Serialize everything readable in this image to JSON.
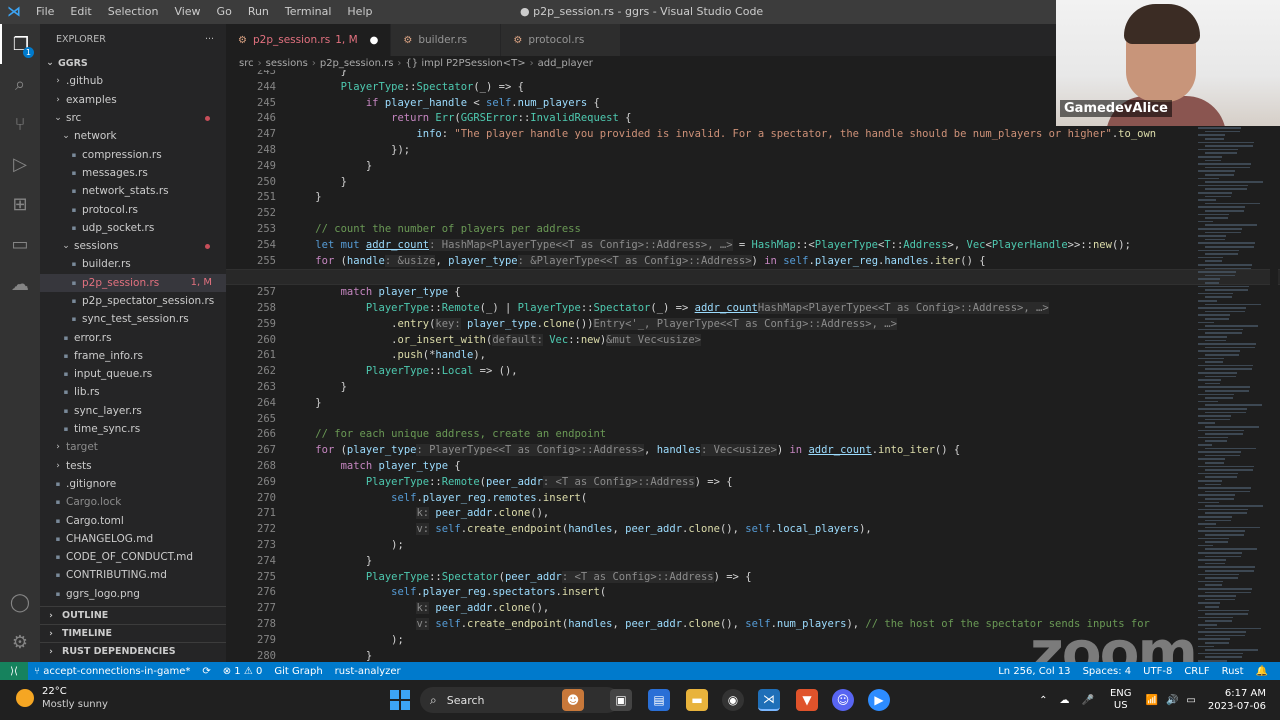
{
  "titlebar": {
    "menu": [
      "File",
      "Edit",
      "Selection",
      "View",
      "Go",
      "Run",
      "Terminal",
      "Help"
    ],
    "window_title": "● p2p_session.rs - ggrs - Visual Studio Code"
  },
  "sidebar": {
    "header": "EXPLORER",
    "more": "···",
    "root": "GGRS",
    "items": [
      {
        "label": ".github",
        "type": "folder",
        "indent": 1,
        "open": false
      },
      {
        "label": "examples",
        "type": "folder",
        "indent": 1,
        "open": false
      },
      {
        "label": "src",
        "type": "folder",
        "indent": 1,
        "open": true,
        "dot": true
      },
      {
        "label": "network",
        "type": "folder",
        "indent": 2,
        "open": true
      },
      {
        "label": "compression.rs",
        "type": "file",
        "indent": 3
      },
      {
        "label": "messages.rs",
        "type": "file",
        "indent": 3
      },
      {
        "label": "network_stats.rs",
        "type": "file",
        "indent": 3
      },
      {
        "label": "protocol.rs",
        "type": "file",
        "indent": 3
      },
      {
        "label": "udp_socket.rs",
        "type": "file",
        "indent": 3
      },
      {
        "label": "sessions",
        "type": "folder",
        "indent": 2,
        "open": true,
        "dot": true
      },
      {
        "label": "builder.rs",
        "type": "file",
        "indent": 3
      },
      {
        "label": "p2p_session.rs",
        "type": "file",
        "indent": 3,
        "selected": true,
        "mod": "1, M"
      },
      {
        "label": "p2p_spectator_session.rs",
        "type": "file",
        "indent": 3
      },
      {
        "label": "sync_test_session.rs",
        "type": "file",
        "indent": 3
      },
      {
        "label": "error.rs",
        "type": "file",
        "indent": 2
      },
      {
        "label": "frame_info.rs",
        "type": "file",
        "indent": 2
      },
      {
        "label": "input_queue.rs",
        "type": "file",
        "indent": 2
      },
      {
        "label": "lib.rs",
        "type": "file",
        "indent": 2
      },
      {
        "label": "sync_layer.rs",
        "type": "file",
        "indent": 2
      },
      {
        "label": "time_sync.rs",
        "type": "file",
        "indent": 2
      },
      {
        "label": "target",
        "type": "folder",
        "indent": 1,
        "open": false,
        "dim": true
      },
      {
        "label": "tests",
        "type": "folder",
        "indent": 1,
        "open": false
      },
      {
        "label": ".gitignore",
        "type": "file",
        "indent": 1
      },
      {
        "label": "Cargo.lock",
        "type": "file",
        "indent": 1,
        "dim": true
      },
      {
        "label": "Cargo.toml",
        "type": "file",
        "indent": 1
      },
      {
        "label": "CHANGELOG.md",
        "type": "file",
        "indent": 1
      },
      {
        "label": "CODE_OF_CONDUCT.md",
        "type": "file",
        "indent": 1
      },
      {
        "label": "CONTRIBUTING.md",
        "type": "file",
        "indent": 1
      },
      {
        "label": "ggrs_logo.png",
        "type": "file",
        "indent": 1
      }
    ],
    "sections": [
      "OUTLINE",
      "TIMELINE",
      "RUST DEPENDENCIES"
    ]
  },
  "tabs": [
    {
      "label": "p2p_session.rs",
      "badge": "1, M",
      "active": true,
      "dirty": true
    },
    {
      "label": "builder.rs",
      "active": false
    },
    {
      "label": "protocol.rs",
      "active": false
    }
  ],
  "breadcrumb": [
    "src",
    "sessions",
    "p2p_session.rs",
    "{} impl P2PSession<T>",
    "add_player"
  ],
  "editor": {
    "current_line": 256,
    "lines": [
      {
        "n": 243,
        "html": "        }"
      },
      {
        "n": 244,
        "html": "        <span class=\"ty\">PlayerType</span>::<span class=\"ty\">Spectator</span>(_) => {"
      },
      {
        "n": 245,
        "html": "            <span class=\"kw\">if</span> <span class=\"vr\">player_handle</span> < <span class=\"kw2\">self</span>.<span class=\"vr\">num_players</span> {"
      },
      {
        "n": 246,
        "html": "                <span class=\"kw\">return</span> <span class=\"ty\">Err</span>(<span class=\"ty\">GGRSError</span>::<span class=\"ty\">InvalidRequest</span> {"
      },
      {
        "n": 247,
        "html": "                    <span class=\"vr\">info</span>: <span class=\"st\">\"The player handle you provided is invalid. For a spectator, the handle should be num_players or higher\"</span>.<span class=\"fn\">to_own</span>"
      },
      {
        "n": 248,
        "html": "                });"
      },
      {
        "n": 249,
        "html": "            }"
      },
      {
        "n": 250,
        "html": "        }"
      },
      {
        "n": 251,
        "html": "    }"
      },
      {
        "n": 252,
        "html": ""
      },
      {
        "n": 253,
        "html": "    <span class=\"cm\">// count the number of players per address</span>"
      },
      {
        "n": 254,
        "html": "    <span class=\"kw2\">let</span> <span class=\"kw2\">mut</span> <span class=\"vr ul\">addr_count</span><span class=\"hint\">: HashMap&lt;PlayerType&lt;&lt;T as Config&gt;::Address&gt;, …&gt;</span> = <span class=\"ty\">HashMap</span>::&lt;<span class=\"ty\">PlayerType</span>&lt;<span class=\"ty\">T</span>::<span class=\"ty\">Address</span>&gt;, <span class=\"ty\">Vec</span>&lt;<span class=\"ty\">PlayerHandle</span>&gt;&gt;::<span class=\"fn\">new</span>();"
      },
      {
        "n": 255,
        "html": "    <span class=\"kw\">for</span> (<span class=\"vr\">handle</span><span class=\"hint\">: &amp;usize</span>, <span class=\"vr\">player_type</span><span class=\"hint\">: &amp;PlayerType&lt;&lt;T as Config&gt;::Address&gt;</span>) <span class=\"kw\">in</span> <span class=\"kw2\">self</span>.<span class=\"vr\">player_reg</span>.<span class=\"vr\">handles</span>.<span class=\"fn\">iter</span>() {"
      },
      {
        "n": 256,
        "html": "        "
      },
      {
        "n": 257,
        "html": "        <span class=\"kw\">match</span> <span class=\"vr\">player_type</span> {"
      },
      {
        "n": 258,
        "html": "            <span class=\"ty\">PlayerType</span>::<span class=\"ty\">Remote</span>(_) | <span class=\"ty\">PlayerType</span>::<span class=\"ty\">Spectator</span>(_) => <span class=\"vr ul\">addr_count</span><span class=\"hint\">HashMap&lt;PlayerType&lt;&lt;T as Config&gt;::Address&gt;, …&gt;</span>"
      },
      {
        "n": 259,
        "html": "                .<span class=\"fn\">entry</span>(<span class=\"hint\">key:</span> <span class=\"vr\">player_type</span>.<span class=\"fn\">clone</span>())<span class=\"hint\">Entry&lt;'_, PlayerType&lt;&lt;T as Config&gt;::Address&gt;, …&gt;</span>"
      },
      {
        "n": 260,
        "html": "                .<span class=\"fn\">or_insert_with</span>(<span class=\"hint\">default:</span> <span class=\"ty\">Vec</span>::<span class=\"fn\">new</span>)<span class=\"hint\">&amp;mut Vec&lt;usize&gt;</span>"
      },
      {
        "n": 261,
        "html": "                .<span class=\"fn\">push</span>(*<span class=\"vr\">handle</span>),"
      },
      {
        "n": 262,
        "html": "            <span class=\"ty\">PlayerType</span>::<span class=\"ty\">Local</span> => (),"
      },
      {
        "n": 263,
        "html": "        }"
      },
      {
        "n": 264,
        "html": "    }"
      },
      {
        "n": 265,
        "html": ""
      },
      {
        "n": 266,
        "html": "    <span class=\"cm\">// for each unique address, create an endpoint</span>"
      },
      {
        "n": 267,
        "html": "    <span class=\"kw\">for</span> (<span class=\"vr\">player_type</span><span class=\"hint\">: PlayerType&lt;&lt;T as Config&gt;::Address&gt;</span>, <span class=\"vr\">handles</span><span class=\"hint\">: Vec&lt;usize&gt;</span>) <span class=\"kw\">in</span> <span class=\"vr ul\">addr_count</span>.<span class=\"fn\">into_iter</span>() {"
      },
      {
        "n": 268,
        "html": "        <span class=\"kw\">match</span> <span class=\"vr\">player_type</span> {"
      },
      {
        "n": 269,
        "html": "            <span class=\"ty\">PlayerType</span>::<span class=\"ty\">Remote</span>(<span class=\"vr\">peer_addr</span><span class=\"hint\">: &lt;T as Config&gt;::Address</span>) => {"
      },
      {
        "n": 270,
        "html": "                <span class=\"kw2\">self</span>.<span class=\"vr\">player_reg</span>.<span class=\"vr\">remotes</span>.<span class=\"fn\">insert</span>("
      },
      {
        "n": 271,
        "html": "                    <span class=\"hint\">k:</span> <span class=\"vr\">peer_addr</span>.<span class=\"fn\">clone</span>(),"
      },
      {
        "n": 272,
        "html": "                    <span class=\"hint\">v:</span> <span class=\"kw2\">self</span>.<span class=\"fn\">create_endpoint</span>(<span class=\"vr\">handles</span>, <span class=\"vr\">peer_addr</span>.<span class=\"fn\">clone</span>(), <span class=\"kw2\">self</span>.<span class=\"vr\">local_players</span>),"
      },
      {
        "n": 273,
        "html": "                );"
      },
      {
        "n": 274,
        "html": "            }"
      },
      {
        "n": 275,
        "html": "            <span class=\"ty\">PlayerType</span>::<span class=\"ty\">Spectator</span>(<span class=\"vr\">peer_addr</span><span class=\"hint\">: &lt;T as Config&gt;::Address</span>) => {"
      },
      {
        "n": 276,
        "html": "                <span class=\"kw2\">self</span>.<span class=\"vr\">player_reg</span>.<span class=\"vr\">spectators</span>.<span class=\"fn\">insert</span>("
      },
      {
        "n": 277,
        "html": "                    <span class=\"hint\">k:</span> <span class=\"vr\">peer_addr</span>.<span class=\"fn\">clone</span>(),"
      },
      {
        "n": 278,
        "html": "                    <span class=\"hint\">v:</span> <span class=\"kw2\">self</span>.<span class=\"fn\">create_endpoint</span>(<span class=\"vr\">handles</span>, <span class=\"vr\">peer_addr</span>.<span class=\"fn\">clone</span>(), <span class=\"kw2\">self</span>.<span class=\"vr\">num_players</span>), <span class=\"cm\">// the host of the spectator sends inputs for</span>"
      },
      {
        "n": 279,
        "html": "                );"
      },
      {
        "n": 280,
        "html": "            }"
      }
    ]
  },
  "webcam": {
    "name": "GamedevAlice"
  },
  "watermark": "zoom",
  "statusbar": {
    "branch": "accept-connections-in-game*",
    "sync": "⟳",
    "problems": "⊗ 1 ⚠ 0",
    "git_graph": "Git Graph",
    "analyzer": "rust-analyzer",
    "position": "Ln 256, Col 13",
    "spaces": "Spaces: 4",
    "encoding": "UTF-8",
    "eol": "CRLF",
    "lang": "Rust"
  },
  "taskbar": {
    "temp": "22°C",
    "weather": "Mostly sunny",
    "search": "Search",
    "lang1": "ENG",
    "lang2": "US",
    "time": "6:17 AM",
    "date": "2023-07-06"
  },
  "colors": {
    "accent": "#007acc",
    "keyword": "#c586c0",
    "type": "#4ec9b0",
    "function": "#dcdcaa",
    "string": "#ce9178",
    "comment": "#6a9955"
  }
}
